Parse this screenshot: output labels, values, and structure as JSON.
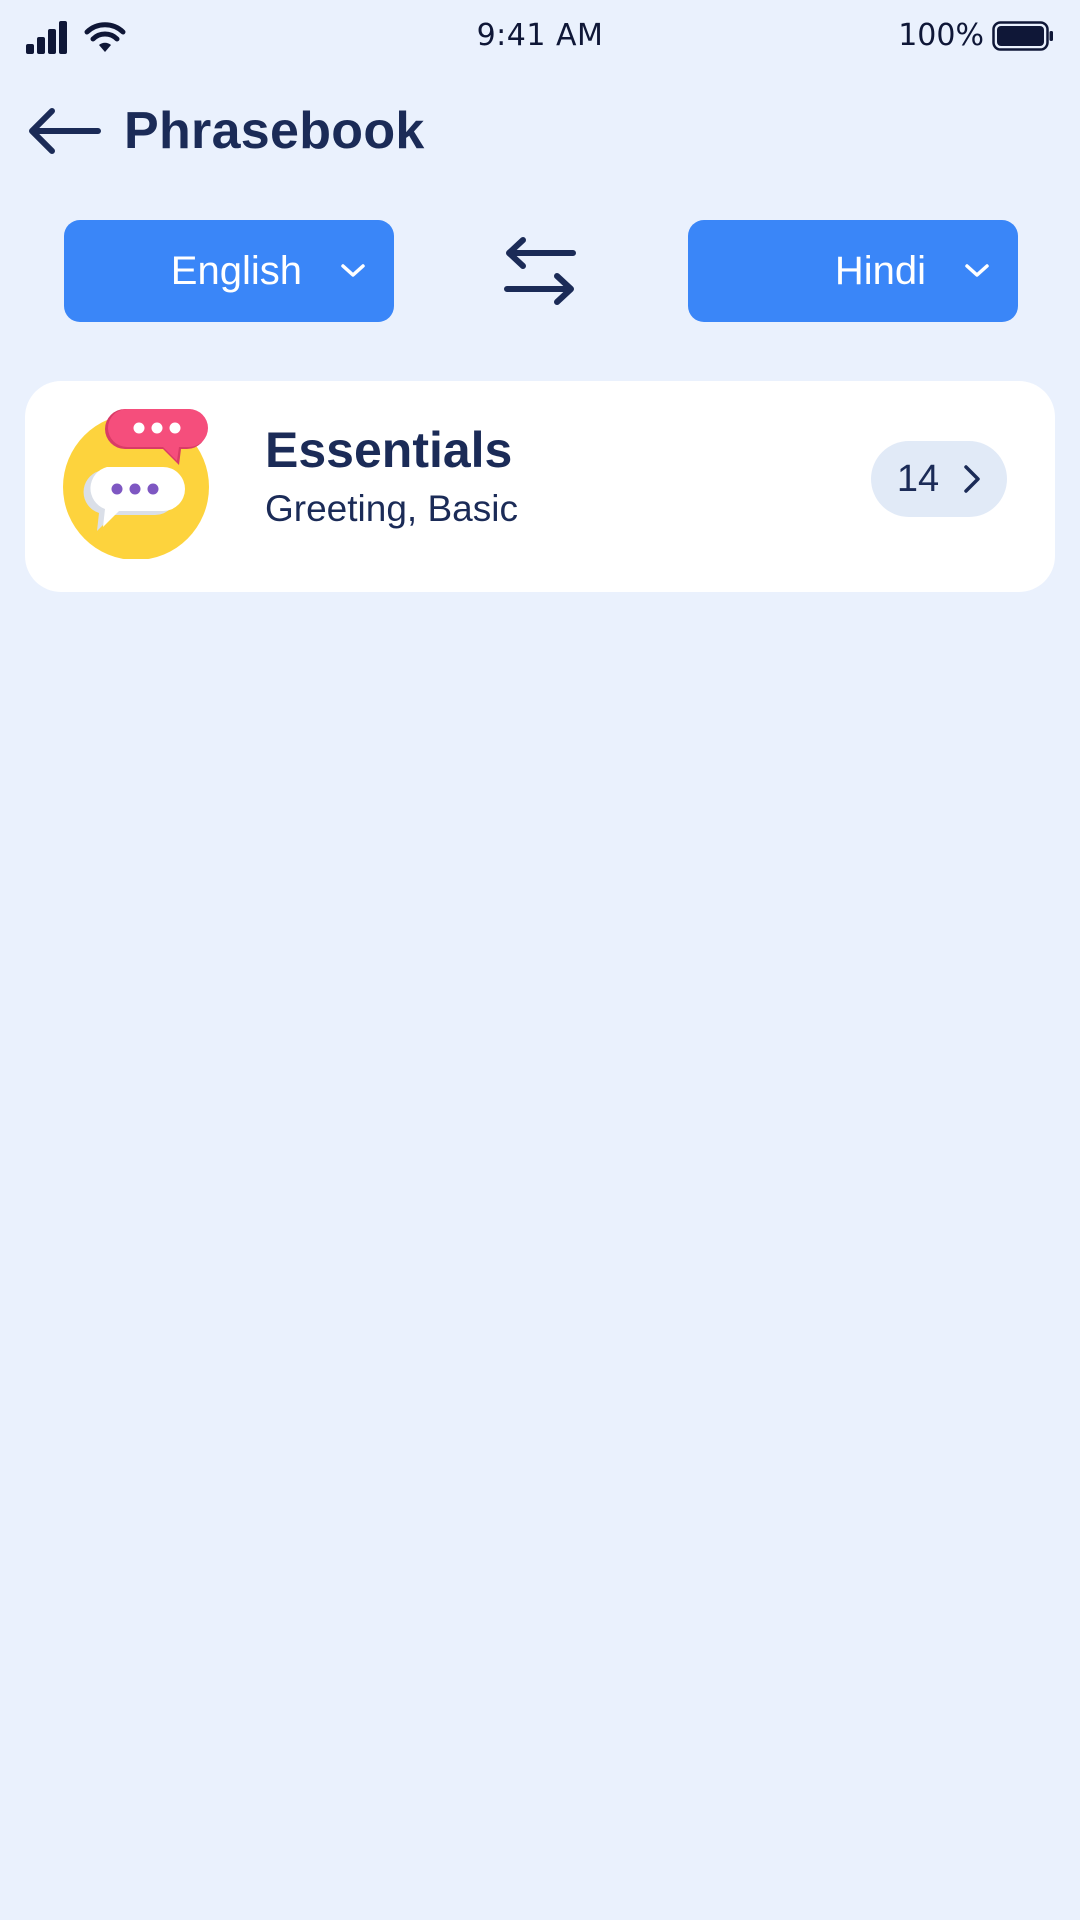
{
  "status_bar": {
    "time": "9:41 AM",
    "battery_percent": "100%",
    "signal_icon": "cellular-signal-icon",
    "wifi_icon": "wifi-icon",
    "battery_icon": "battery-full-icon"
  },
  "header": {
    "back_icon": "arrow-left-icon",
    "title": "Phrasebook"
  },
  "languages": {
    "source": "English",
    "target": "Hindi",
    "swap_icon": "swap-arrows-icon",
    "dropdown_icon": "chevron-down-icon"
  },
  "categories": [
    {
      "title": "Essentials",
      "subtitle": "Greeting, Basic",
      "count": "14",
      "icon": "chat-bubbles-icon",
      "chevron_icon": "chevron-right-icon"
    }
  ],
  "colors": {
    "background": "#EAF1FD",
    "accent": "#3A86F8",
    "text_primary": "#1B2B57",
    "card": "#FFFFFF",
    "pill": "#E1EAF7",
    "icon_yellow": "#FDD33D",
    "icon_pink": "#F54E7C",
    "icon_purple": "#7E57C2"
  }
}
